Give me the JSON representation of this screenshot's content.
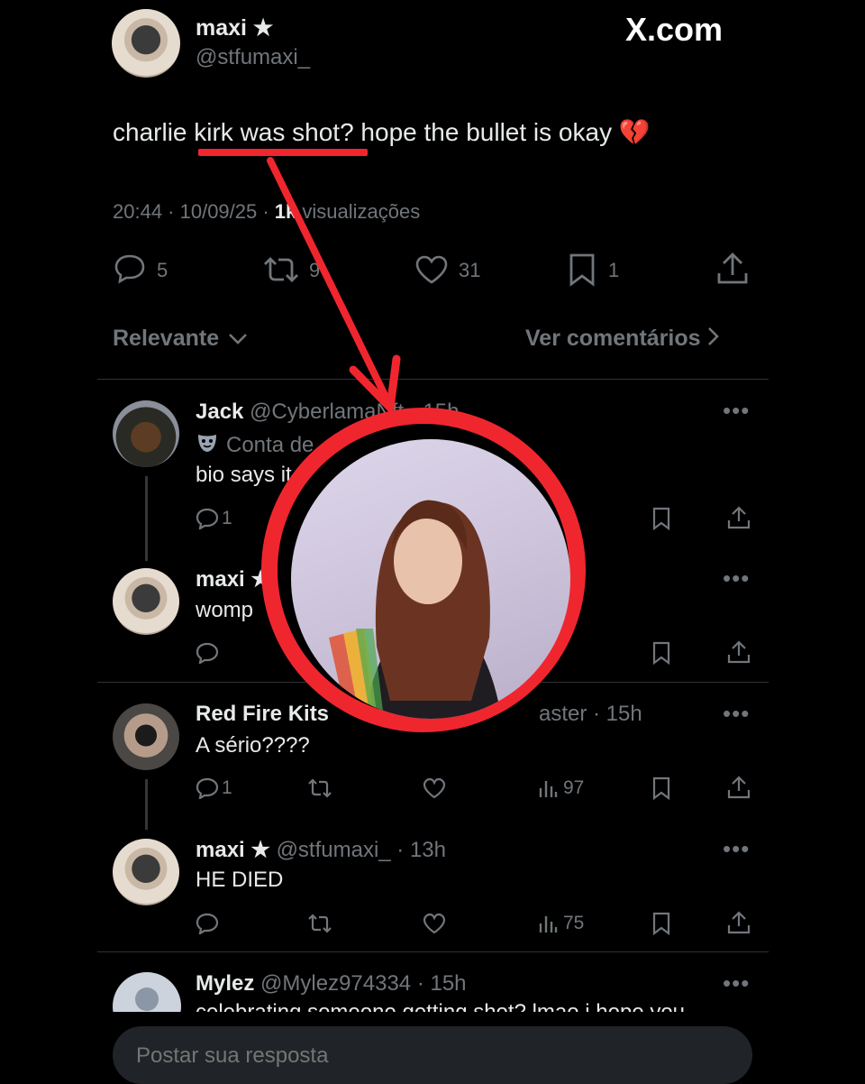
{
  "post": {
    "name": "maxi ★",
    "handle": "@stfumaxi_",
    "brand": "X.com",
    "text": "charlie kirk was shot? hope the bullet is okay 💔",
    "meta_time": "20:44 · 10/09/25 · ",
    "meta_views": "1k",
    "meta_views_label": "visualizações",
    "stats": {
      "replies": "5",
      "reposts": "9",
      "likes": "31",
      "bookmarks": "1"
    }
  },
  "sort": {
    "label": "Relevante",
    "link": "Ver comentários"
  },
  "replies": [
    {
      "name": "Jack",
      "handle": "@CyberlamaNft · 15h",
      "badge": "Conta de",
      "text": "bio says it",
      "reply_count": "1"
    },
    {
      "name": "maxi ★",
      "text": "womp"
    },
    {
      "name": "Red Fire Kits",
      "handle_tail": "aster · 15h",
      "text": "A sério????",
      "reply_count": "1",
      "views": "97"
    },
    {
      "name": "maxi ★",
      "handle": "@stfumaxi_ · 13h",
      "text": "HE DIED",
      "views": "75"
    },
    {
      "name": "Mylez",
      "handle": "@Mylez974334 · 15h",
      "text": "celebrating someone getting shot? lmao i hope you"
    }
  ],
  "composer": {
    "placeholder": "Postar sua resposta"
  },
  "colors": {
    "annotation": "#f0262f",
    "background": "#000000",
    "muted": "#71767b"
  }
}
